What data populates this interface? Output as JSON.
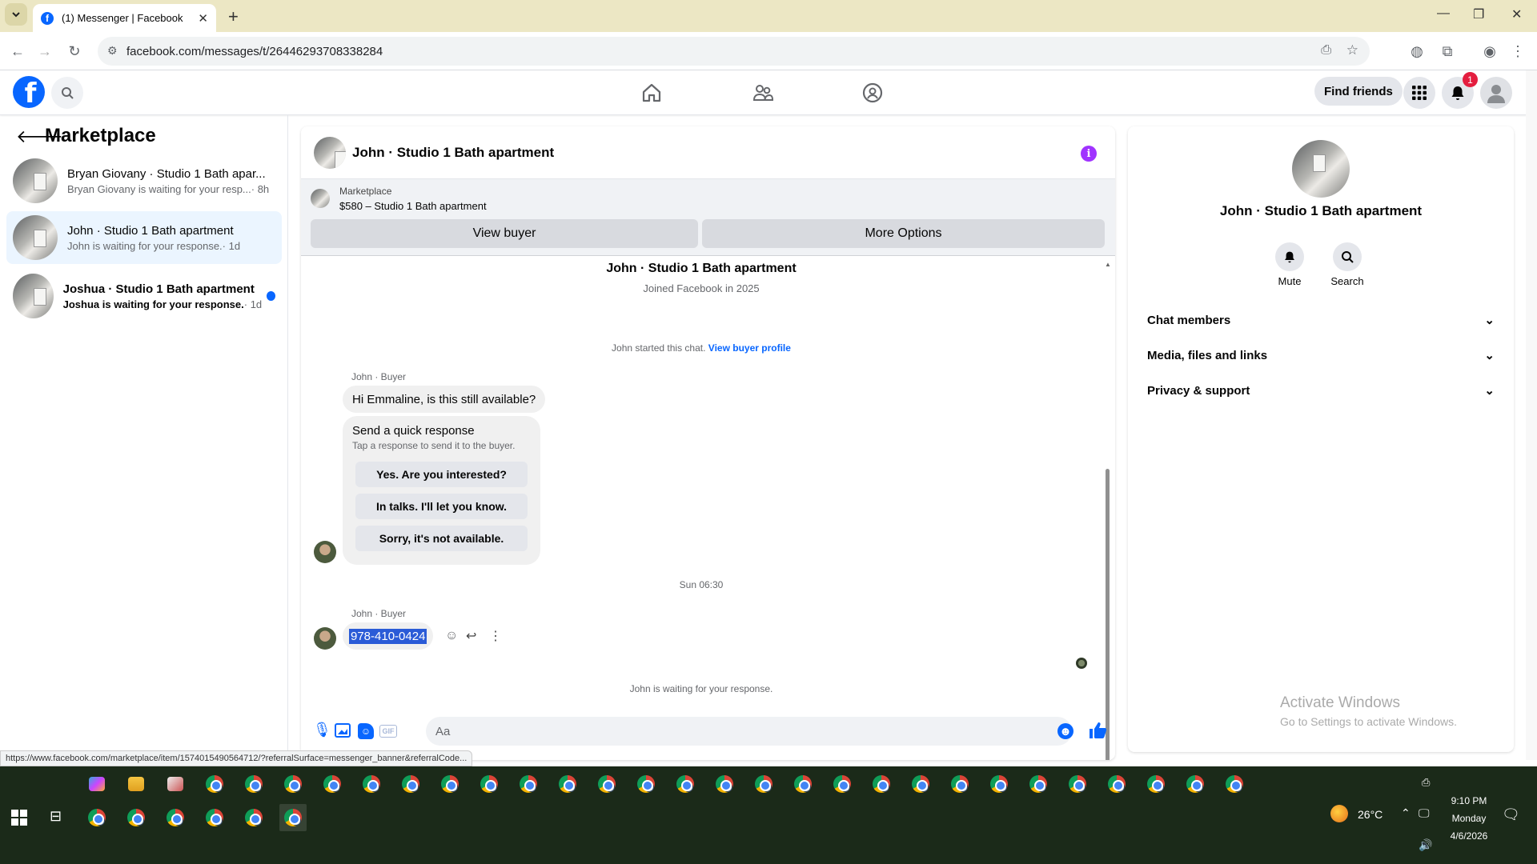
{
  "browser": {
    "tab_title": "(1) Messenger | Facebook",
    "url": "facebook.com/messages/t/26446293708338284",
    "status_url": "https://www.facebook.com/marketplace/item/1574015490564712/?referralSurface=messenger_banner&referralCode..."
  },
  "header": {
    "find_friends": "Find friends",
    "notif_count": "1"
  },
  "left": {
    "title": "Marketplace",
    "conversations": [
      {
        "title": "Bryan Giovany · Studio 1 Bath apar...",
        "snippet": "Bryan Giovany is waiting for your resp...",
        "time": "· 8h",
        "unread": false
      },
      {
        "title": "John · Studio 1 Bath apartment",
        "snippet": "John is waiting for your response.",
        "time": "· 1d",
        "unread": false
      },
      {
        "title": "Joshua · Studio 1 Bath apartment",
        "snippet": "Joshua is waiting for your response.",
        "time": "· 1d",
        "unread": true
      }
    ]
  },
  "chat": {
    "title": "John · Studio 1 Bath apartment",
    "listing_source": "Marketplace",
    "listing": "$580 – Studio 1 Bath apartment",
    "view_buyer": "View buyer",
    "more_options": "More Options",
    "intro_name": "John · Studio 1 Bath apartment",
    "joined": "Joined Facebook in 2025",
    "started": "John started this chat.",
    "view_profile": "View buyer profile",
    "sender1": "John · Buyer",
    "msg1": "Hi Emmaline, is this still available?",
    "quick_title": "Send a quick response",
    "quick_sub": "Tap a response to send it to the buyer.",
    "quick_replies": [
      "Yes. Are you interested?",
      "In talks. I'll let you know.",
      "Sorry, it's not available."
    ],
    "timestamp": "Sun 06:30",
    "sender2": "John · Buyer",
    "msg2": "978-410-0424",
    "waiting": "John is waiting for your response.",
    "input_placeholder": "Aa"
  },
  "details": {
    "name": "John · Studio 1 Bath apartment",
    "mute": "Mute",
    "search": "Search",
    "sections": [
      "Chat members",
      "Media, files and links",
      "Privacy & support"
    ],
    "activate_title": "Activate Windows",
    "activate_sub": "Go to Settings to activate Windows."
  },
  "taskbar": {
    "temp": "26°C",
    "time": "9:10 PM",
    "day": "Monday",
    "date": "4/6/2026"
  },
  "colors": {
    "fb_blue": "#0866ff",
    "accent_purple": "#a033ff",
    "unread_dot": "#0866ff",
    "selected_bg": "#ebf5ff"
  }
}
